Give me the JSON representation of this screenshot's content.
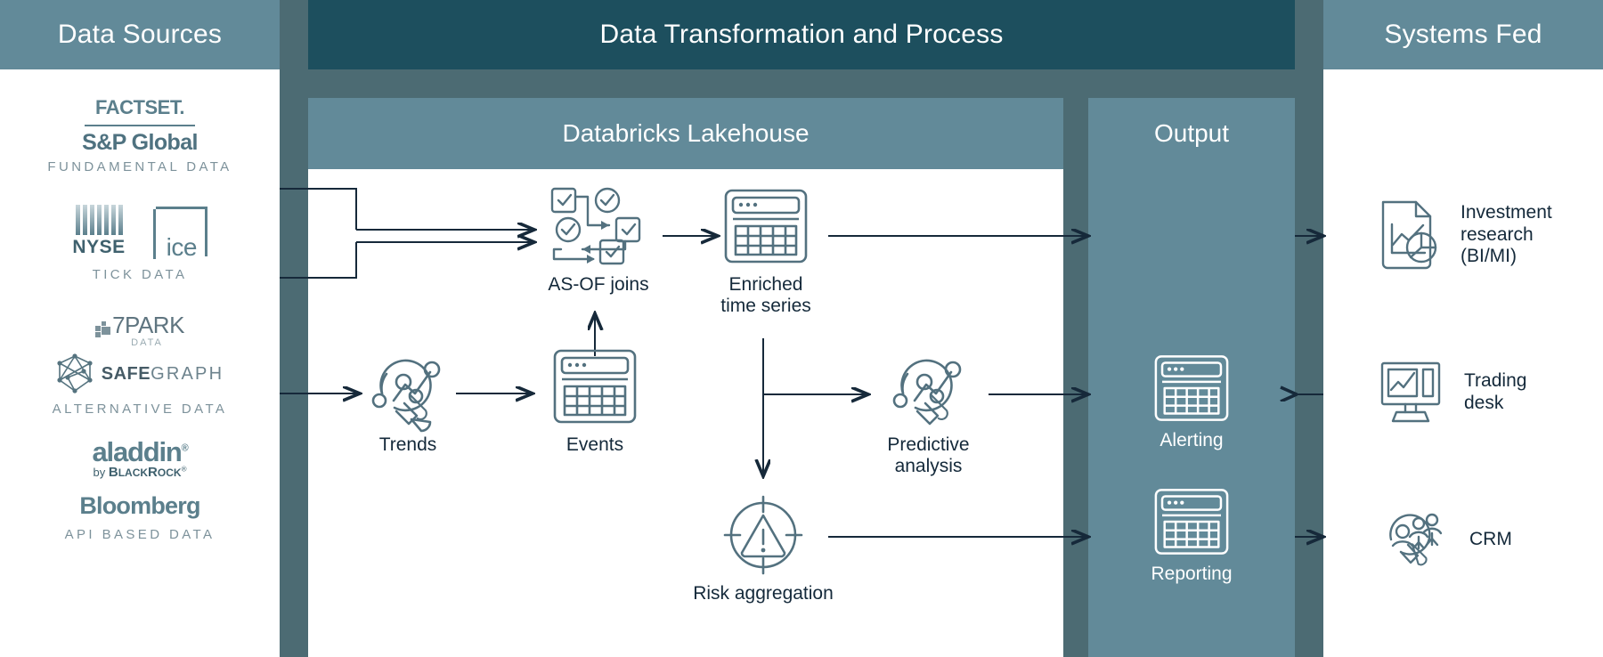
{
  "headers": {
    "left": "Data Sources",
    "middle": "Data Transformation and Process",
    "right": "Systems Fed"
  },
  "panels": {
    "lakehouse": "Databricks Lakehouse",
    "output": "Output"
  },
  "colors": {
    "header_left": "#628a99",
    "header_middle": "#1d4f5e",
    "header_right": "#628a99",
    "mid_container": "#4c6b73",
    "panel_lakehouse_header": "#628a99",
    "panel_output": "#628a99",
    "logo_teal": "#5b7f8c",
    "label_dark": "#14293a",
    "caption_gray": "#7d929b",
    "icon_stroke": "#53717f"
  },
  "data_sources": [
    {
      "id": "fundamental",
      "caption": "FUNDAMENTAL DATA",
      "logos": [
        {
          "name": "factset-logo",
          "text": "FACTSET"
        },
        {
          "name": "sp-global-logo",
          "text": "S&P Global"
        }
      ]
    },
    {
      "id": "tick",
      "caption": "TICK DATA",
      "logos": [
        {
          "name": "nyse-logo",
          "text": "NYSE"
        },
        {
          "name": "ice-logo",
          "text": "ice"
        }
      ]
    },
    {
      "id": "alternative",
      "caption": "ALTERNATIVE DATA",
      "logos": [
        {
          "name": "sevenpark-logo",
          "text": "7PARK",
          "sub": "DATA"
        },
        {
          "name": "safegraph-logo",
          "text_bold": "SAFE",
          "text_light": "GRAPH"
        }
      ]
    },
    {
      "id": "api",
      "caption": "API BASED DATA",
      "logos": [
        {
          "name": "aladdin-logo",
          "text": "aladdin",
          "sub_pre": "by ",
          "sub_bold": "B",
          "sub": "LACK",
          "sub2": "R",
          "sub3": "OCK"
        },
        {
          "name": "bloomberg-logo",
          "text": "Bloomberg"
        }
      ]
    }
  ],
  "lakehouse_nodes": [
    {
      "id": "as-of-joins",
      "label": "AS-OF joins",
      "icon": "checklist-flow-icon"
    },
    {
      "id": "enriched-time-series",
      "label": "Enriched\ntime series",
      "icon": "table-window-icon"
    },
    {
      "id": "trends",
      "label": "Trends",
      "icon": "magnifier-network-icon"
    },
    {
      "id": "events",
      "label": "Events",
      "icon": "table-window-icon"
    },
    {
      "id": "predictive-analysis",
      "label": "Predictive\nanalysis",
      "icon": "magnifier-network-icon"
    },
    {
      "id": "risk-aggregation",
      "label": "Risk aggregation",
      "icon": "target-warning-icon"
    }
  ],
  "output_nodes": [
    {
      "id": "alerting",
      "label": "Alerting",
      "icon": "table-window-icon"
    },
    {
      "id": "reporting",
      "label": "Reporting",
      "icon": "table-window-icon"
    }
  ],
  "systems_fed": [
    {
      "id": "investment-research",
      "label": "Investment\nresearch\n(BI/MI)",
      "icon": "document-chart-icon"
    },
    {
      "id": "trading-desk",
      "label": "Trading\ndesk",
      "icon": "monitor-chart-icon"
    },
    {
      "id": "crm",
      "label": "CRM",
      "icon": "magnifier-people-icon"
    }
  ]
}
